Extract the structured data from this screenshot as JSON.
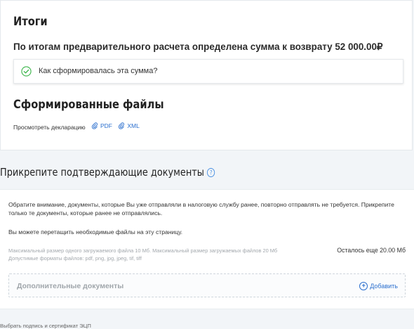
{
  "results": {
    "title": "Итоги",
    "summary": "По итогам предварительного расчета определена сумма к возврату 52 000.00₽",
    "accordion_label": "Как сформировалась эта сумма?"
  },
  "files": {
    "title": "Сформированные файлы",
    "view_label": "Просмотреть декларацию",
    "pdf_label": "PDF",
    "xml_label": "XML"
  },
  "attach": {
    "title": "Прикрепите подтверждающие документы",
    "help_symbol": "?",
    "notice": "Обратите внимание, документы, которые Вы уже отправляли в налоговую службу ранее, повторно отправлять не требуется. Прикрепите только те документы, которые ранее не отправлялись.",
    "drag_hint": "Вы можете перетащить необходимые файлы на эту страницу.",
    "limits_line1": "Максимальный размер одного загружаемого файла 10 Мб. Максимальный размер загружаемых файлов 20 Мб",
    "limits_line2": "Допустимые форматы файлов: pdf, png, jpg, jpeg, tif, tiff",
    "remaining": "Осталось еще 20.00 Мб",
    "dropzone_label": "Дополнительные документы",
    "add_label": "Добавить"
  },
  "footer": {
    "partial_text": "Выбрать подпись и сертификат ЭЦП"
  },
  "colors": {
    "accent": "#2b6fce",
    "success": "#3bb54a"
  }
}
